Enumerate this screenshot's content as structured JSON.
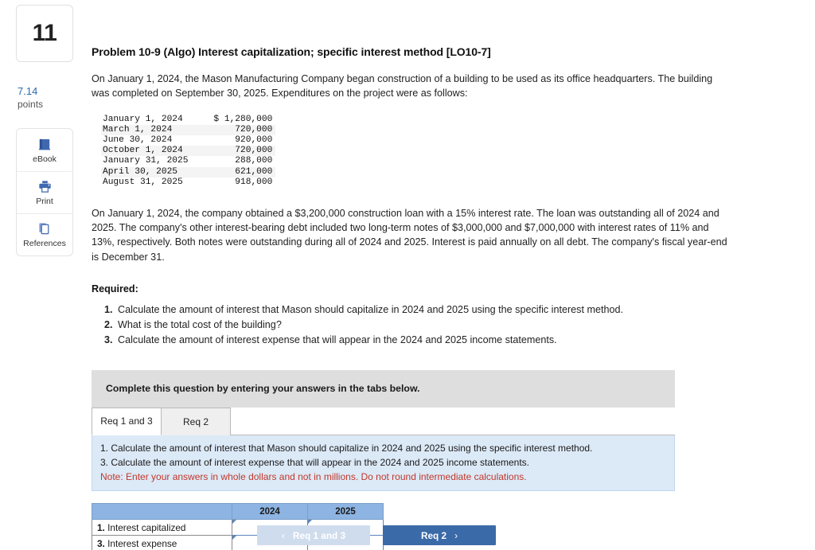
{
  "sidebar": {
    "question_number": "11",
    "points_value": "7.14",
    "points_label": "points",
    "tools": [
      {
        "label": "eBook",
        "icon": "book-icon"
      },
      {
        "label": "Print",
        "icon": "printer-icon"
      },
      {
        "label": "References",
        "icon": "references-icon"
      }
    ]
  },
  "problem": {
    "title": "Problem 10-9 (Algo) Interest capitalization; specific interest method [LO10-7]",
    "para1": "On January 1, 2024, the Mason Manufacturing Company began construction of a building to be used as its office headquarters. The building was completed on September 30, 2025. Expenditures on the project were as follows:",
    "para2": "On January 1, 2024, the company obtained a $3,200,000 construction loan with a 15% interest rate. The loan was outstanding all of 2024 and 2025. The company's other interest-bearing debt included two long-term notes of $3,000,000 and $7,000,000 with interest rates of 11% and 13%, respectively. Both notes were outstanding during all of 2024 and 2025. Interest is paid annually on all debt. The company's fiscal year-end is December 31.",
    "expenditures": [
      {
        "date": "January 1, 2024",
        "currency": "$",
        "amount": "1,280,000"
      },
      {
        "date": "March 1, 2024",
        "currency": "",
        "amount": "720,000"
      },
      {
        "date": "June 30, 2024",
        "currency": "",
        "amount": "920,000"
      },
      {
        "date": "October 1, 2024",
        "currency": "",
        "amount": "720,000"
      },
      {
        "date": "January 31, 2025",
        "currency": "",
        "amount": "288,000"
      },
      {
        "date": "April 30, 2025",
        "currency": "",
        "amount": "621,000"
      },
      {
        "date": "August 31, 2025",
        "currency": "",
        "amount": "918,000"
      }
    ],
    "required_heading": "Required:",
    "requirements": [
      {
        "num": "1.",
        "text": "Calculate the amount of interest that Mason should capitalize in 2024 and 2025 using the specific interest method."
      },
      {
        "num": "2.",
        "text": "What is the total cost of the building?"
      },
      {
        "num": "3.",
        "text": "Calculate the amount of interest expense that will appear in the 2024 and 2025 income statements."
      }
    ]
  },
  "answer_area": {
    "banner": "Complete this question by entering your answers in the tabs below.",
    "tabs": [
      {
        "label": "Req 1 and 3",
        "active": true
      },
      {
        "label": "Req 2",
        "active": false
      }
    ],
    "info_lines": [
      "1. Calculate the amount of interest that Mason should capitalize in 2024 and 2025 using the specific interest method.",
      "3. Calculate the amount of interest expense that will appear in the 2024 and 2025 income statements."
    ],
    "info_note": "Note: Enter your answers in whole dollars and not in millions. Do not round intermediate calculations.",
    "table": {
      "headers": [
        "",
        "2024",
        "2025"
      ],
      "rows": [
        {
          "num": "1.",
          "label": " Interest capitalized",
          "v2024": "",
          "v2025": ""
        },
        {
          "num": "3.",
          "label": " Interest expense",
          "v2024": "",
          "v2025": ""
        }
      ]
    }
  },
  "navigation": {
    "prev_label": "Req 1 and 3",
    "prev_chevron": "‹",
    "next_label": "Req 2",
    "next_chevron": "›"
  },
  "colors": {
    "accent_blue": "#3b6aa8",
    "header_blue": "#8db4e2",
    "info_blue": "#dce9f7",
    "note_red": "#c0392b",
    "banner_gray": "#dedede"
  }
}
